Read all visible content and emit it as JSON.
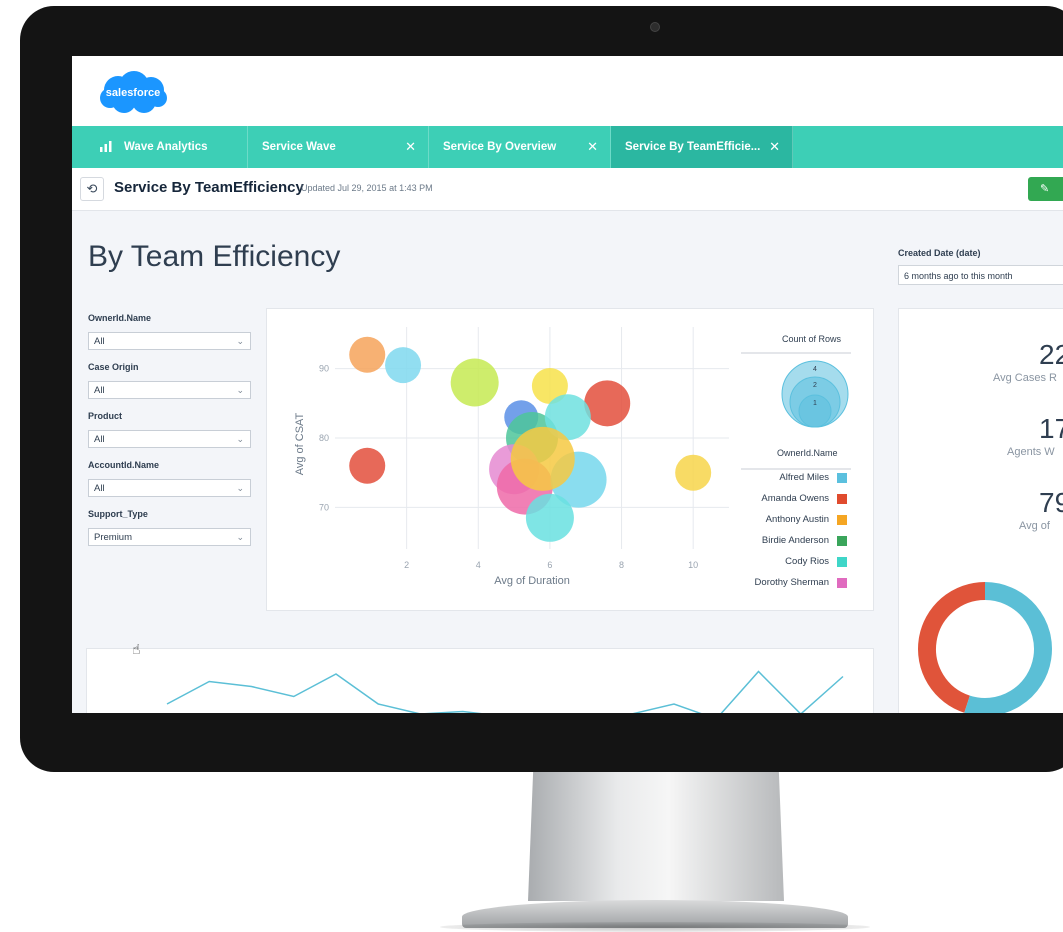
{
  "brand": {
    "logo_text": "salesforce",
    "cloud_color": "#1b96ff"
  },
  "tabs": [
    {
      "label": "Wave Analytics",
      "icon": "bar-chart-icon",
      "closable": false,
      "active": false
    },
    {
      "label": "Service Wave",
      "closable": true,
      "active": false
    },
    {
      "label": "Service By Overview",
      "closable": true,
      "active": false
    },
    {
      "label": "Service By TeamEfficie...",
      "closable": true,
      "active": true
    }
  ],
  "close_glyph": "✕",
  "titlebar": {
    "back_icon": "undo-icon",
    "title": "Service By TeamEfficiency",
    "updated": "Updated Jul 29, 2015 at 1:43 PM"
  },
  "page": {
    "heading": "By Team Efficiency"
  },
  "date_filter": {
    "label": "Created Date (date)",
    "value": "6 months ago to this month"
  },
  "filters": [
    {
      "label": "OwnerId.Name",
      "value": "All"
    },
    {
      "label": "Case Origin",
      "value": "All"
    },
    {
      "label": "Product",
      "value": "All"
    },
    {
      "label": "AccountId.Name",
      "value": "All"
    },
    {
      "label": "Support_Type",
      "value": "Premium"
    }
  ],
  "kpis": [
    {
      "value": "22",
      "label": "Avg Cases R"
    },
    {
      "value": "17",
      "label": "Agents W"
    },
    {
      "value": "79",
      "label": "Avg of"
    }
  ],
  "colors": {
    "tab_bar": "#3dcfb6",
    "tab_active": "#2bb7a1",
    "edit_button": "#32a852",
    "donut_orange": "#e0543a",
    "donut_blue": "#5bbfd6",
    "line_chart": "#5bbfd6"
  },
  "chart_data": {
    "type": "scatter",
    "xlabel": "Avg of Duration",
    "ylabel": "Avg of CSAT",
    "xlim": [
      0,
      11
    ],
    "ylim": [
      64,
      96
    ],
    "xticks": [
      2,
      4,
      6,
      8,
      10
    ],
    "yticks": [
      70,
      80,
      90
    ],
    "grid": true,
    "size_legend": {
      "title": "Count of Rows",
      "values": [
        "4",
        "2",
        "1"
      ]
    },
    "color_legend_title": "OwnerId.Name",
    "legend_entries": [
      {
        "name": "Alfred Miles",
        "color": "#5bc0de"
      },
      {
        "name": "Amanda Owens",
        "color": "#e04b2e"
      },
      {
        "name": "Anthony Austin",
        "color": "#f5a623"
      },
      {
        "name": "Birdie Anderson",
        "color": "#3aa55b"
      },
      {
        "name": "Cody Rios",
        "color": "#3fd6c8"
      },
      {
        "name": "Dorothy Sherman",
        "color": "#e06bbf"
      }
    ],
    "points": [
      {
        "x": 0.9,
        "y": 92,
        "r": 18,
        "color": "#f6a35a"
      },
      {
        "x": 1.9,
        "y": 90.5,
        "r": 18,
        "color": "#7fd8ef"
      },
      {
        "x": 3.9,
        "y": 88,
        "r": 24,
        "color": "#c6ea52"
      },
      {
        "x": 6.0,
        "y": 87.5,
        "r": 18,
        "color": "#f7e24a"
      },
      {
        "x": 7.6,
        "y": 85,
        "r": 23,
        "color": "#e34f3c"
      },
      {
        "x": 5.2,
        "y": 83,
        "r": 17,
        "color": "#5b8fe6"
      },
      {
        "x": 5.5,
        "y": 80,
        "r": 26,
        "color": "#4dc59a"
      },
      {
        "x": 6.5,
        "y": 83,
        "r": 23,
        "color": "#6fe0df"
      },
      {
        "x": 5.0,
        "y": 75.5,
        "r": 25,
        "color": "#e58ad1"
      },
      {
        "x": 5.3,
        "y": 73,
        "r": 28,
        "color": "#ee6aa8"
      },
      {
        "x": 6.8,
        "y": 74,
        "r": 28,
        "color": "#76d7ec"
      },
      {
        "x": 5.8,
        "y": 77,
        "r": 32,
        "color": "#f6c942"
      },
      {
        "x": 6.0,
        "y": 68.5,
        "r": 24,
        "color": "#69e0e0"
      },
      {
        "x": 0.9,
        "y": 76,
        "r": 18,
        "color": "#e34f3c"
      },
      {
        "x": 10.0,
        "y": 75,
        "r": 18,
        "color": "#f7d54a"
      }
    ]
  },
  "line_chart": {
    "type": "line",
    "x": [
      0,
      1,
      2,
      3,
      4,
      5,
      6,
      7,
      8,
      9,
      10,
      11,
      12,
      13,
      14,
      15,
      16
    ],
    "y": [
      0.3,
      0.75,
      0.65,
      0.45,
      0.9,
      0.3,
      0.1,
      0.15,
      0.05,
      0.1,
      0.0,
      0.1,
      0.3,
      0.0,
      0.95,
      0.1,
      0.85
    ]
  },
  "donut": {
    "segments": [
      {
        "fraction": 0.45,
        "color": "#e0543a"
      },
      {
        "fraction": 0.55,
        "color": "#5bbfd6"
      }
    ]
  }
}
